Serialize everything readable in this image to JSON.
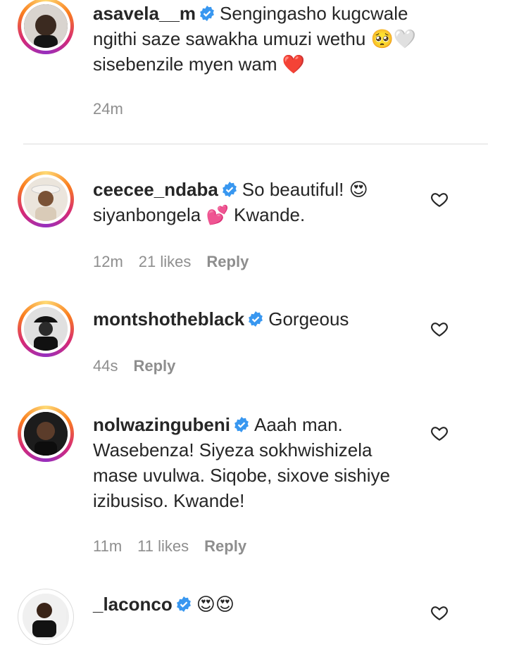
{
  "comments": [
    {
      "username": "asavela__m",
      "text_lines": [
        "Sengingasho kugcwale",
        "ngithi saze sawakha umuzi wethu 🥺🤍",
        "sisebenzile myen wam ❤️"
      ],
      "time": "24m",
      "likes": "",
      "reply": ""
    },
    {
      "username": "ceecee_ndaba",
      "text_lines": [
        "So beautiful! 😍",
        "siyanbongela 💕 Kwande."
      ],
      "time": "12m",
      "likes": "21 likes",
      "reply": "Reply"
    },
    {
      "username": "montshotheblack",
      "text_lines": [
        "Gorgeous"
      ],
      "time": "44s",
      "likes": "",
      "reply": "Reply"
    },
    {
      "username": "nolwazingubeni",
      "text_lines": [
        "Aaah man.",
        "Wasebenza! Siyeza sokhwishizela",
        "mase uvulwa. Siqobe, sixove sishiye",
        "izibusiso. Kwande!"
      ],
      "time": "11m",
      "likes": "11 likes",
      "reply": "Reply"
    },
    {
      "username": "_laconco",
      "text_lines": [
        "😍😍"
      ],
      "time": "",
      "likes": "",
      "reply": ""
    }
  ],
  "colors": {
    "verified": "#3897f0",
    "meta_text": "#8e8e8e",
    "text": "#262626"
  },
  "icons": {
    "verified": "verified-badge-icon",
    "like": "heart-outline-icon"
  }
}
